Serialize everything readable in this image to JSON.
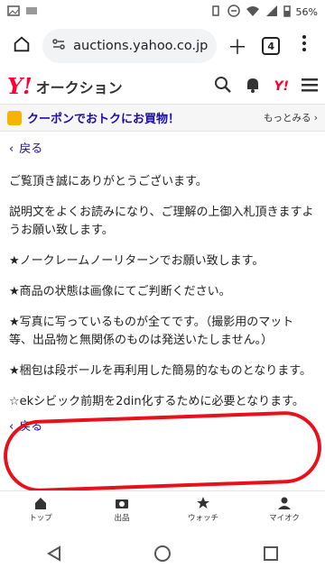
{
  "statusbar": {
    "left_icons": [
      "image-icon",
      "notification-icon"
    ],
    "battery": "56%"
  },
  "browser": {
    "url": "auctions.yahoo.co.jp",
    "tabs_count": "4"
  },
  "header": {
    "logo": "Y!",
    "title": "オークション",
    "mark": "Y!"
  },
  "coupon": {
    "text": "クーポンでおトクにお買物！",
    "more": "もっとみる"
  },
  "content": {
    "back_label": "戻る",
    "paragraphs": [
      "ご覧頂き誠にありがとうございます。",
      "説明文をよくお読みになり、ご理解の上御入札頂きますようお願い致します。",
      "★ノークレームノーリターンでお願い致します。",
      "★商品の状態は画像にてご判断ください。",
      "★写真に写っているものが全てです。（撮影用のマット等、出品物と無関係のものは発送いたしません。）",
      "★梱包は段ボールを再利用した簡易的なものとなります。",
      "☆ekシビック前期を2din化するために必要となります。"
    ],
    "back_label_bottom": "戻る"
  },
  "bottom_nav": [
    {
      "label": "トップ",
      "icon": "home-icon"
    },
    {
      "label": "出品",
      "icon": "camera-icon"
    },
    {
      "label": "ウォッチ",
      "icon": "star-icon"
    },
    {
      "label": "マイオク",
      "icon": "person-icon"
    }
  ],
  "colors": {
    "yahoo_red": "#ff0033",
    "link": "#1a0dab",
    "highlight": "#e8101a"
  }
}
